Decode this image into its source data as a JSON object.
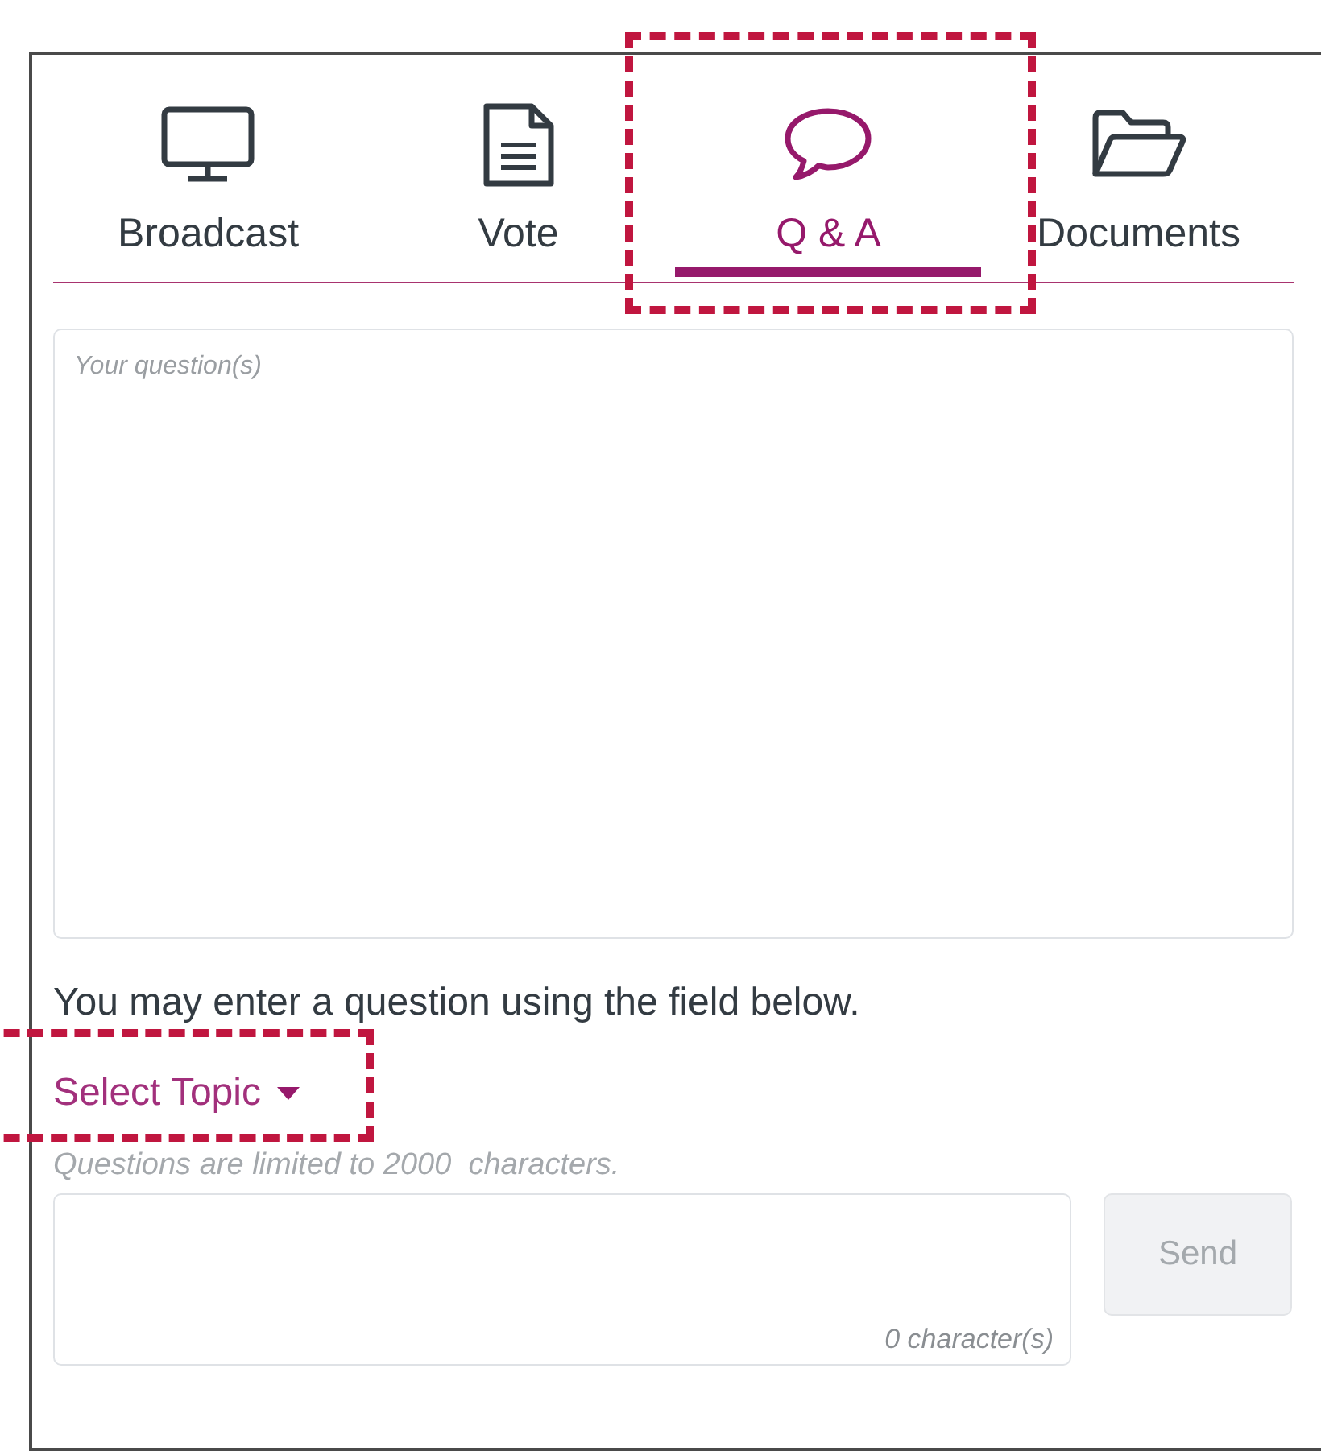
{
  "tabs": [
    {
      "label": "Broadcast",
      "kind": "monitor",
      "selected": false,
      "highlighted": false
    },
    {
      "label": "Vote",
      "kind": "document",
      "selected": false,
      "highlighted": false
    },
    {
      "label": "Q & A",
      "kind": "chat",
      "selected": true,
      "highlighted": true
    },
    {
      "label": "Documents",
      "kind": "folder",
      "selected": false,
      "highlighted": false
    }
  ],
  "question_log": {
    "placeholder": "Your question(s)"
  },
  "instruction": "You may enter a question using the field below.",
  "topic_selector": {
    "label": "Select Topic",
    "highlighted": true
  },
  "limit_hint": "Questions are limited to 2000  characters.",
  "question_input": {
    "counter": "0 character(s)"
  },
  "send_button": {
    "label": "Send",
    "disabled": true
  }
}
